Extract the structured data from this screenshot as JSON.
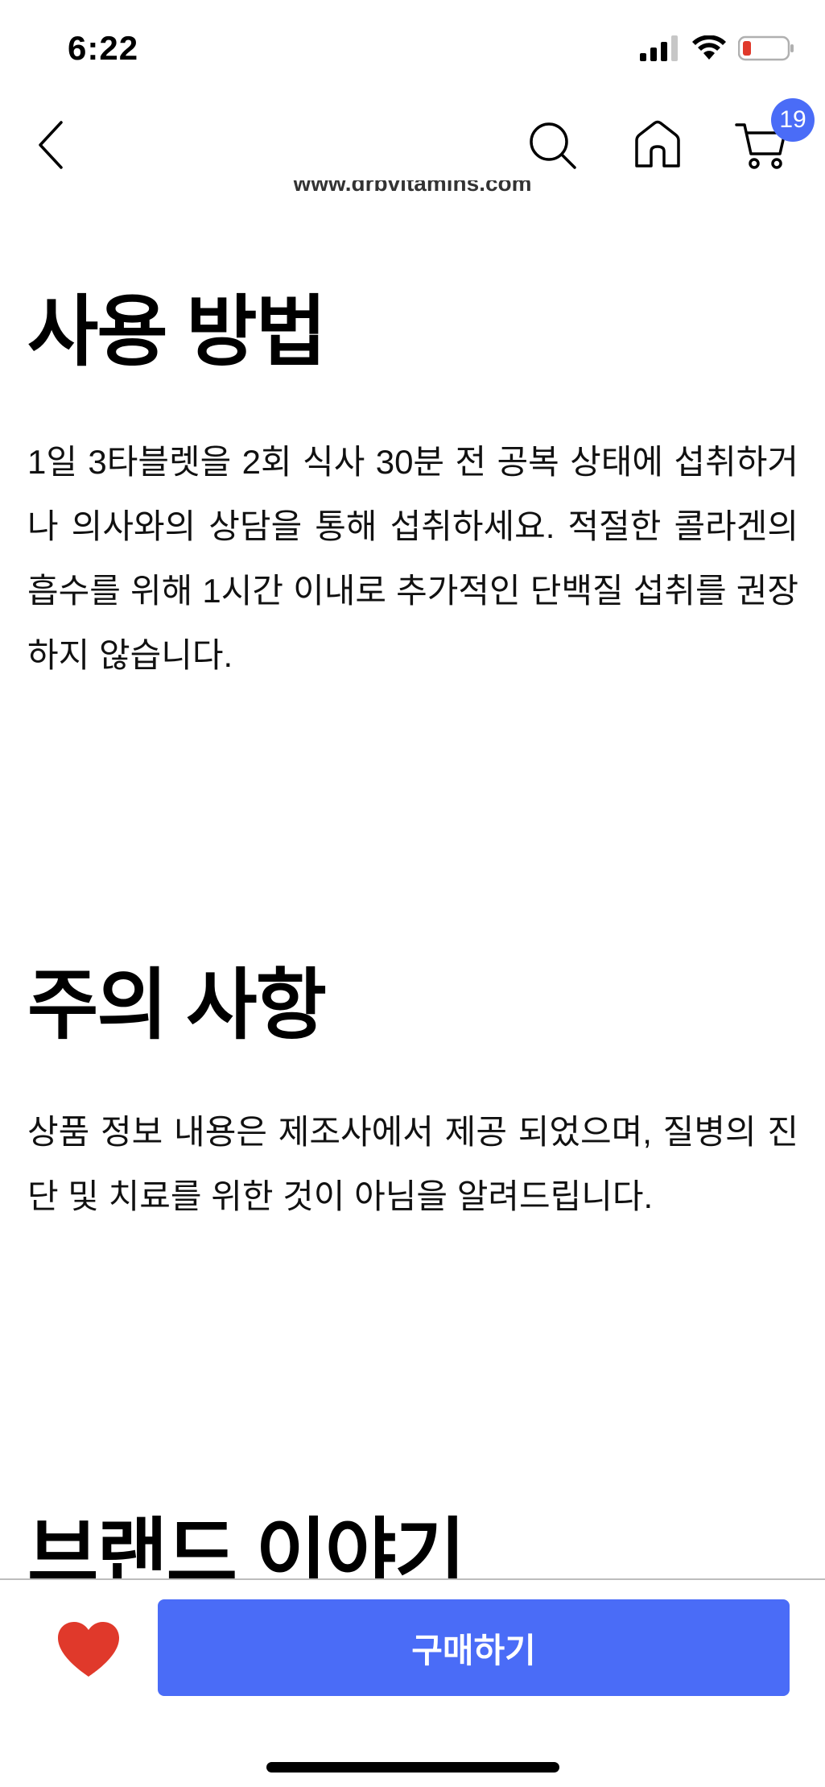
{
  "status_bar": {
    "time": "6:22"
  },
  "nav": {
    "back_icon": "chevron-left-icon",
    "search_icon": "search-icon",
    "home_icon": "home-icon",
    "cart_icon": "cart-icon",
    "cart_count": "19"
  },
  "content": {
    "cut_url": "www.drbvitamins.com",
    "usage": {
      "title": "사용 방법",
      "body": "1일 3타블렛을 2회 식사 30분 전 공복 상태에 섭취하거나 의사와의 상담을 통해 섭취하세요. 적절한 콜라겐의 흡수를 위해 1시간 이내로 추가적인 단백질 섭취를 권장하지 않습니다."
    },
    "caution": {
      "title": "주의 사항",
      "body": "상품 정보 내용은 제조사에서 제공 되었으며, 질병의 진단 및 치료를 위한 것이 아님을 알려드립니다."
    },
    "brand": {
      "title": "브랜드 이야기"
    }
  },
  "bottom_bar": {
    "favorite_icon": "heart-icon",
    "buy_label": "구매하기"
  },
  "colors": {
    "accent": "#4a6cf7",
    "heart": "#e0392b",
    "battery_low": "#e0392b"
  }
}
